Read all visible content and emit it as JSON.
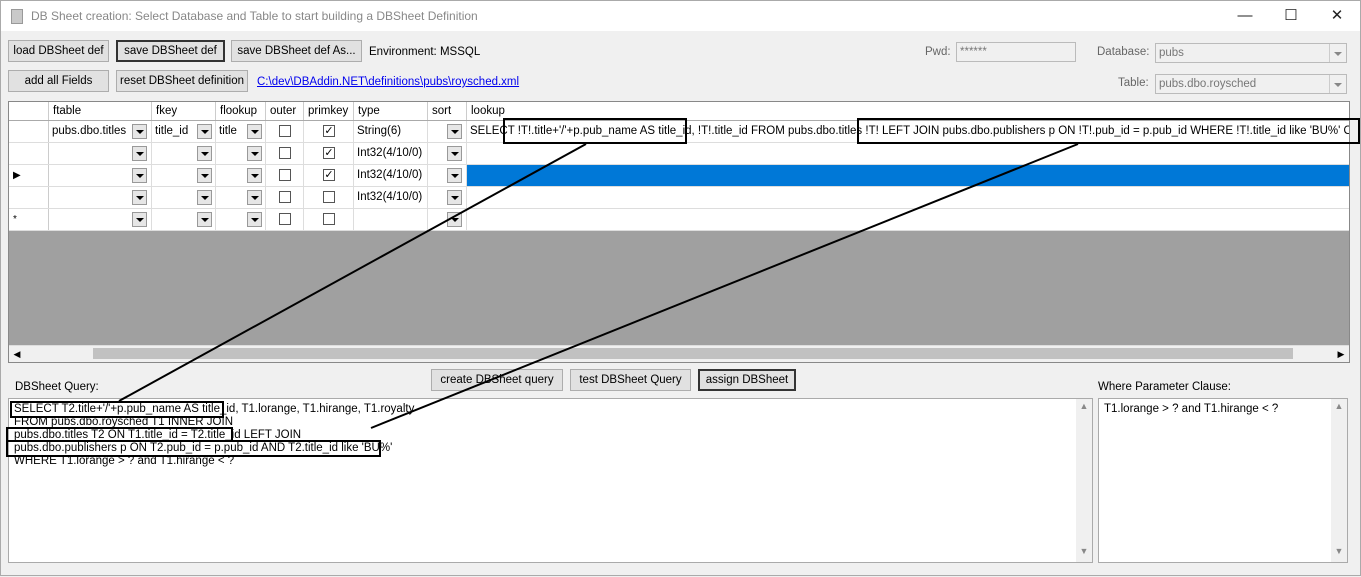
{
  "window": {
    "title": "DB Sheet creation: Select Database and Table to start building a DBSheet Definition"
  },
  "toolbar": {
    "load": "load DBSheet def",
    "save": "save DBSheet def",
    "save_as": "save DBSheet def As...",
    "environment": "Environment: MSSQL",
    "add_all": "add all Fields",
    "reset": "reset DBSheet definition",
    "path": "C:\\dev\\DBAddin.NET\\definitions\\pubs\\roysched.xml",
    "pwd_label": "Pwd:",
    "pwd_value": "******",
    "db_label": "Database:",
    "db_value": "pubs",
    "table_label": "Table:",
    "table_value": "pubs.dbo.roysched"
  },
  "grid": {
    "columns": [
      "ftable",
      "fkey",
      "flookup",
      "outer",
      "primkey",
      "type",
      "sort",
      "lookup"
    ],
    "rows": [
      {
        "marker": "",
        "ftable": "pubs.dbo.titles",
        "fkey": "title_id",
        "flookup": "title",
        "outer": false,
        "primkey": true,
        "type": "String(6)",
        "lookup": "SELECT !T!.title+'/'+p.pub_name AS title_id, !T!.title_id FROM pubs.dbo.titles !T! LEFT JOIN pubs.dbo.publishers p ON !T!.pub_id = p.pub_id WHERE !T!.title_id like 'BU%' ORDER BY !"
      },
      {
        "marker": "",
        "ftable": "",
        "fkey": "",
        "flookup": "",
        "outer": false,
        "primkey": true,
        "type": "Int32(4/10/0)",
        "lookup": ""
      },
      {
        "marker": "▶",
        "ftable": "",
        "fkey": "",
        "flookup": "",
        "outer": false,
        "primkey": true,
        "type": "Int32(4/10/0)",
        "lookup": ""
      },
      {
        "marker": "",
        "ftable": "",
        "fkey": "",
        "flookup": "",
        "outer": false,
        "primkey": false,
        "type": "Int32(4/10/0)",
        "lookup": ""
      },
      {
        "marker": "*",
        "ftable": "",
        "fkey": "",
        "flookup": "",
        "outer": false,
        "primkey": false,
        "type": "",
        "lookup": ""
      }
    ]
  },
  "actions": {
    "create": "create DBSheet query",
    "test": "test DBSheet Query",
    "assign": "assign DBSheet"
  },
  "query": {
    "label": "DBSheet Query:",
    "lines": [
      "SELECT T2.title+'/'+p.pub_name AS title_id, T1.lorange, T1.hirange, T1.royalty",
      "FROM pubs.dbo.roysched T1 INNER JOIN",
      "pubs.dbo.titles T2 ON T1.title_id = T2.title_id LEFT JOIN",
      "pubs.dbo.publishers p ON T2.pub_id = p.pub_id AND T2.title_id like 'BU%'",
      "WHERE T1.lorange > ? and T1.hirange < ?"
    ]
  },
  "where": {
    "label": "Where Parameter Clause:",
    "value": "T1.lorange > ? and T1.hirange < ?"
  }
}
